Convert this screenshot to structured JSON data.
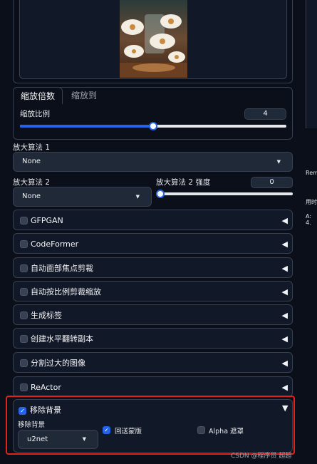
{
  "tabs": {
    "active": "缩放倍数",
    "inactive": "缩放到"
  },
  "scale": {
    "label": "缩放比例",
    "value": "4",
    "fraction": 0.5
  },
  "upscaler1": {
    "label": "放大算法 1",
    "value": "None"
  },
  "upscaler2": {
    "label": "放大算法 2",
    "value": "None"
  },
  "upscaler2_strength": {
    "label": "放大算法 2 强度",
    "value": "0",
    "fraction": 0.0
  },
  "accordions": [
    {
      "label": "GFPGAN"
    },
    {
      "label": "CodeFormer"
    },
    {
      "label": "自动面部焦点剪裁"
    },
    {
      "label": "自动按比例剪裁缩放"
    },
    {
      "label": "生成标签"
    },
    {
      "label": "创建水平翻转副本"
    },
    {
      "label": "分割过大的图像"
    },
    {
      "label": "ReActor"
    }
  ],
  "remove_bg": {
    "header": "移除背景",
    "model_label": "移除背景",
    "model_value": "u2net",
    "return_mask": "回送蒙版",
    "alpha_matting": "Alpha 遮罩"
  },
  "right_panel": {
    "text1": "Rem",
    "text2": "用时",
    "text3": "A: 4."
  },
  "watermark": "CSDN @程序员 超超",
  "colors": {
    "accent": "#2563eb",
    "highlight": "#e1251b",
    "bg": "#0b0f19"
  }
}
